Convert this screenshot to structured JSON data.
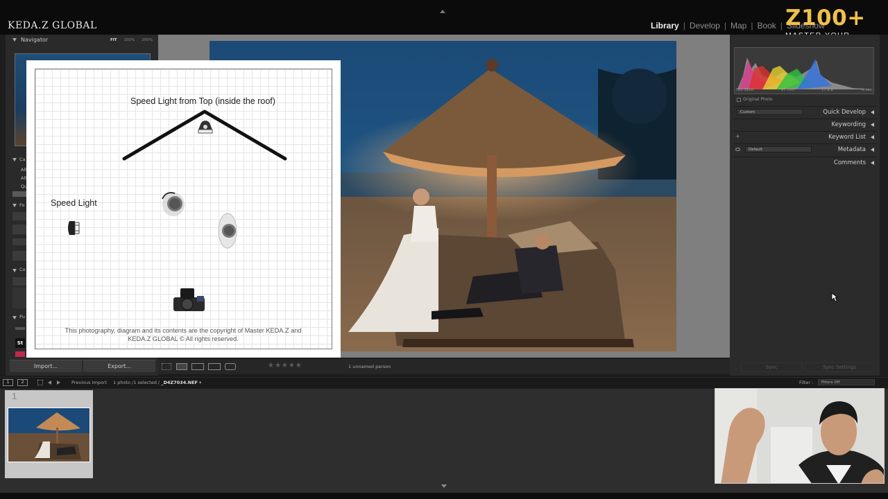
{
  "brand": "KEDA.Z GLOBAL",
  "modules": [
    {
      "label": "Library",
      "active": true
    },
    {
      "label": "Develop",
      "active": false
    },
    {
      "label": "Map",
      "active": false
    },
    {
      "label": "Book",
      "active": false
    },
    {
      "label": "Slideshow",
      "active": false
    }
  ],
  "logo": {
    "title": "Z100+",
    "tagline": "MASTER YOUR CRAFT"
  },
  "navigator": {
    "title": "Navigator",
    "zoom": [
      "FIT",
      "100%",
      "200%"
    ],
    "active_zoom": "FIT"
  },
  "left_panel": {
    "import_label": "Import...",
    "export_label": "Export..."
  },
  "diagram": {
    "title": "Speed Light from Top (inside the roof)",
    "side_label": "Speed Light",
    "copyright": "This photography, diagram and its contents are the copyright of Master KEDA.Z and KEDA.Z GLOBAL © All rights reserved."
  },
  "toolbar": {
    "face_label": "1 unnamed person"
  },
  "right_panel": {
    "histogram": {
      "iso": "ISO 3200",
      "focal": "17 mm",
      "aperture": "ƒ / 2.8",
      "shutter": "⅙ sec"
    },
    "original_photo": "Original Photo",
    "sections": [
      {
        "label": "Quick Develop",
        "select": "Custom"
      },
      {
        "label": "Keywording"
      },
      {
        "label": "Keyword List",
        "prefix": "+"
      },
      {
        "label": "Metadata",
        "select": "Default"
      },
      {
        "label": "Comments"
      }
    ],
    "sync_label": "Sync",
    "sync_settings_label": "Sync Settings"
  },
  "filmstrip_bar": {
    "view1": "1",
    "view2": "2",
    "source": "Previous Import",
    "count_text": "1 photo /1 selected /",
    "filename": "_D4Z7034.NEF",
    "filter_label": "Filter :",
    "filter_value": "Filters Off"
  },
  "filmstrip": {
    "cell_number": "1"
  }
}
